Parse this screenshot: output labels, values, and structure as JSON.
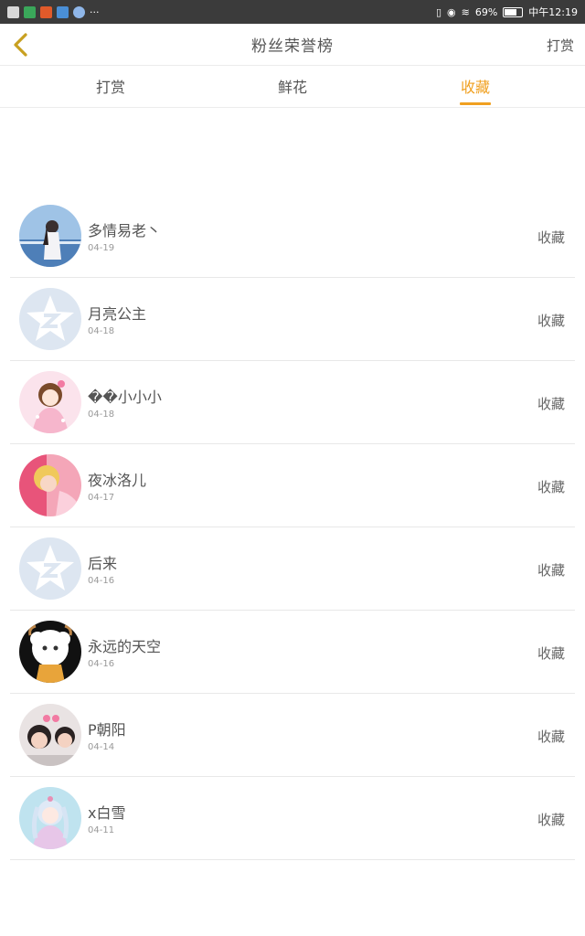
{
  "status_bar": {
    "battery": "69%",
    "time": "中午12:19",
    "more": "···",
    "battery_level": 0.69
  },
  "header": {
    "title": "粉丝荣誉榜",
    "right_button": "打赏",
    "accent_color": "#c8a020"
  },
  "tabs": [
    {
      "label": "打赏",
      "active": false
    },
    {
      "label": "鲜花",
      "active": false
    },
    {
      "label": "收藏",
      "active": true
    }
  ],
  "colors": {
    "active_tab": "#f0a020",
    "text": "#555555",
    "date": "#999999",
    "default_avatar_bg": "#dde6f1"
  },
  "fans": [
    {
      "name": "多情易老丶",
      "date": "04-19",
      "action": "收藏",
      "avatar": "photo-girl-by-sea"
    },
    {
      "name": "月亮公主",
      "date": "04-18",
      "action": "收藏",
      "avatar": "default-qq-star-icon"
    },
    {
      "name": "��小小小",
      "date": "04-18",
      "action": "收藏",
      "avatar": "anime-girl-pink"
    },
    {
      "name": "夜冰洛儿",
      "date": "04-17",
      "action": "收藏",
      "avatar": "photo-girl-pink"
    },
    {
      "name": "后来",
      "date": "04-16",
      "action": "收藏",
      "avatar": "default-qq-star-icon"
    },
    {
      "name": "永远的天空",
      "date": "04-16",
      "action": "收藏",
      "avatar": "cartoon-sheep"
    },
    {
      "name": "P朝阳",
      "date": "04-14",
      "action": "收藏",
      "avatar": "photo-two-kids"
    },
    {
      "name": "x白雪",
      "date": "04-11",
      "action": "收藏",
      "avatar": "anime-girl-blue"
    }
  ]
}
